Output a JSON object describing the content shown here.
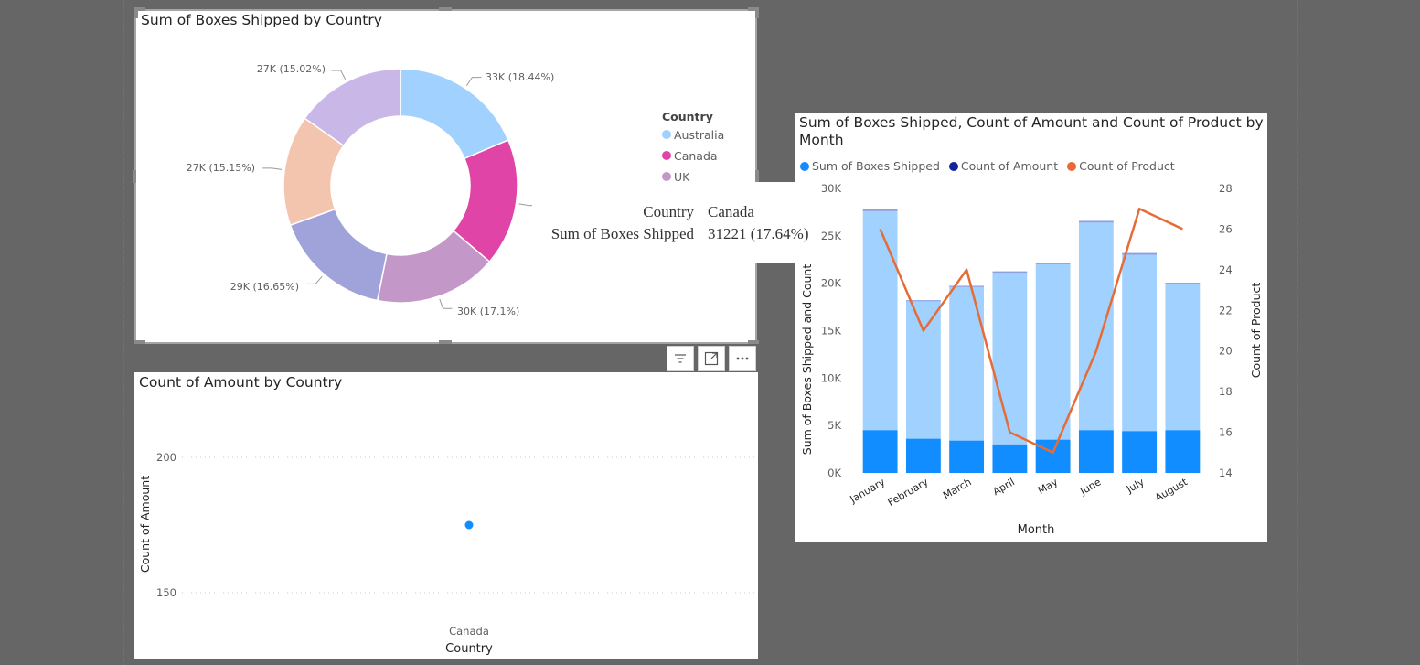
{
  "colors": {
    "australia": "#a0d1ff",
    "canada": "#e044a7",
    "uk": "#c497c9",
    "s4": "#a0a3d9",
    "s5": "#f4c5ae",
    "s6": "#c9b7e8",
    "boxes": "#118dff",
    "boxes_light": "#a0d1ff",
    "amount": "#12239e",
    "product": "#e66c37"
  },
  "donut": {
    "title": "Sum of Boxes Shipped by Country",
    "legend_title": "Country",
    "legend": [
      "Australia",
      "Canada",
      "UK"
    ],
    "labels": {
      "australia": "33K (18.44%)",
      "uk": "30K (17.1%)",
      "s4": "29K (16.65%)",
      "s5": "27K (15.15%)",
      "s6": "27K (15.02%)"
    }
  },
  "tooltip": {
    "k1": "Country",
    "v1": "Canada",
    "k2": "Sum of Boxes Shipped",
    "v2": "31221 (17.64%)"
  },
  "scatter": {
    "title": "Count of Amount by Country",
    "ylabel": "Count of Amount",
    "xlabel": "Country",
    "ticks": [
      "200",
      "150"
    ],
    "category": "Canada"
  },
  "combo": {
    "title_line1": "Sum of Boxes Shipped, Count of Amount and Count of Product by",
    "title_line2": "Month",
    "legend": [
      "Sum of Boxes Shipped",
      "Count of Amount",
      "Count of Product"
    ],
    "ylabel_left": "Sum of Boxes Shipped and Count",
    "ylabel_right": "Count of Product",
    "xlabel": "Month",
    "yticks_left": [
      "30K",
      "25K",
      "20K",
      "15K",
      "10K",
      "5K",
      "0K"
    ],
    "yticks_right": [
      "28",
      "26",
      "24",
      "22",
      "20",
      "18",
      "16",
      "14"
    ]
  },
  "chart_data": [
    {
      "type": "pie",
      "title": "Sum of Boxes Shipped by Country",
      "legend_title": "Country",
      "categories": [
        "Australia",
        "Canada",
        "UK",
        "",
        "",
        ""
      ],
      "values": [
        33000,
        31221,
        30000,
        29000,
        27000,
        27000
      ],
      "percent": [
        18.44,
        17.64,
        17.1,
        16.65,
        15.15,
        15.02
      ],
      "hole": true,
      "legend_position": "right"
    },
    {
      "type": "scatter",
      "title": "Count of Amount by Country",
      "xlabel": "Country",
      "ylabel": "Count of Amount",
      "categories": [
        "Canada"
      ],
      "values": [
        175
      ],
      "ylim": [
        140,
        210
      ]
    },
    {
      "type": "bar",
      "title": "Sum of Boxes Shipped, Count of Amount and Count of Product by Month",
      "xlabel": "Month",
      "ylabel": "Sum of Boxes Shipped and Count",
      "y2label": "Count of Product",
      "categories": [
        "January",
        "February",
        "March",
        "April",
        "May",
        "June",
        "July",
        "August"
      ],
      "series": [
        {
          "name": "Sum of Boxes Shipped",
          "values": [
            27600,
            18100,
            19600,
            21100,
            22000,
            26400,
            23000,
            19900
          ],
          "stacked": true
        },
        {
          "name": "Count of Amount",
          "values": [
            200,
            120,
            130,
            160,
            170,
            180,
            190,
            160
          ],
          "stacked": true
        },
        {
          "name": "Count of Product",
          "values": [
            26,
            21,
            24,
            16,
            15,
            20,
            27,
            26
          ],
          "axis": "right",
          "type": "line"
        }
      ],
      "highlighted_values": [
        4500,
        3600,
        3400,
        3000,
        3500,
        4500,
        4400,
        4500
      ],
      "ylim": [
        0,
        30000
      ],
      "y2lim": [
        14,
        28
      ],
      "legend_position": "top-left",
      "grid": false
    }
  ]
}
